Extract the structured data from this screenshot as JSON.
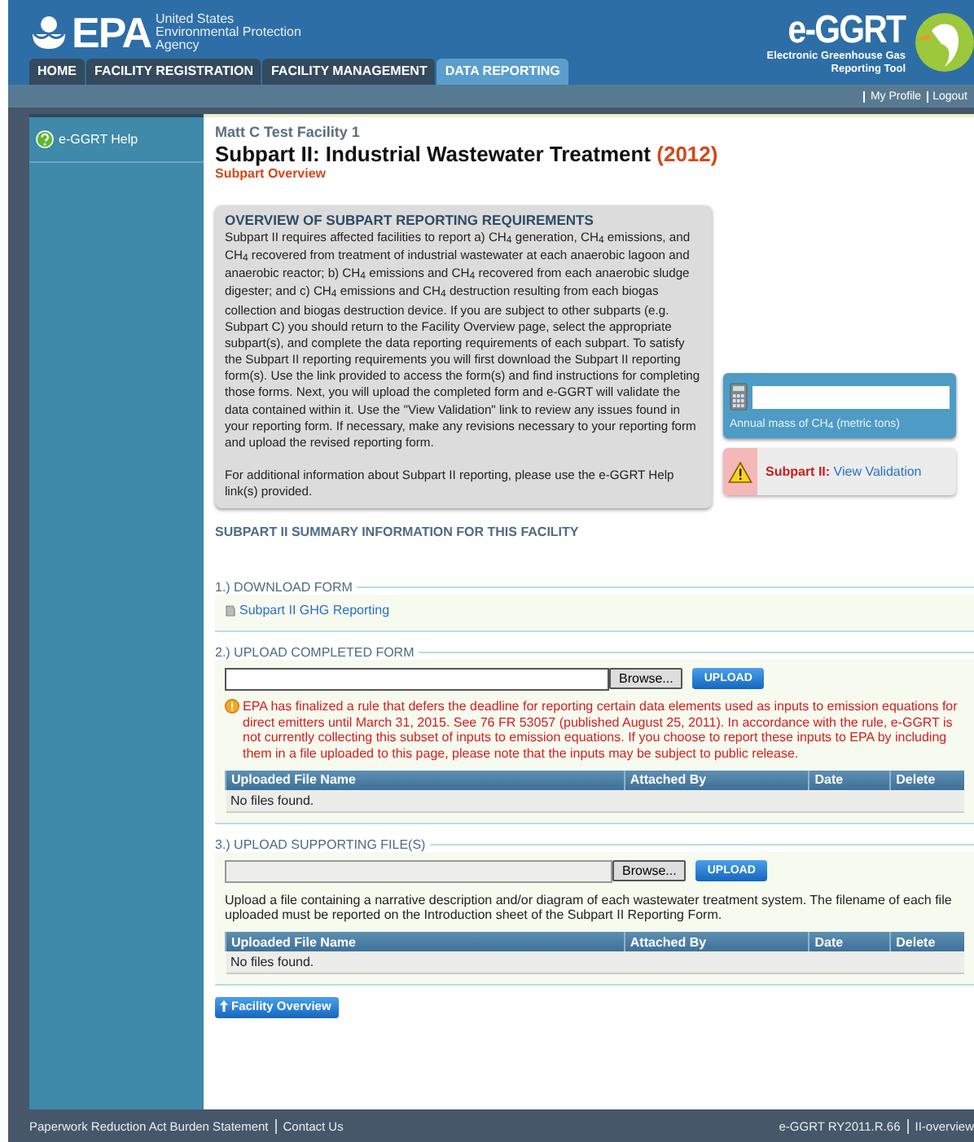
{
  "header": {
    "logo": "EPA",
    "agency_lines": [
      "United States",
      "Environmental Protection",
      "Agency"
    ],
    "app_logo": "e-GGRT",
    "app_subtitle_lines": [
      "Electronic Greenhouse Gas",
      "Reporting Tool"
    ]
  },
  "tabs": [
    {
      "label": "HOME",
      "selected": false
    },
    {
      "label": "FACILITY REGISTRATION",
      "selected": false
    },
    {
      "label": "FACILITY MANAGEMENT",
      "selected": false
    },
    {
      "label": "DATA REPORTING",
      "selected": true
    }
  ],
  "user_links": [
    "My Profile",
    "Logout"
  ],
  "sidebar": {
    "items": [
      {
        "label": "e-GGRT Help"
      }
    ]
  },
  "page": {
    "facility": "Matt C Test Facility 1",
    "title": "Subpart II: Industrial Wastewater Treatment",
    "year": "(2012)",
    "subtitle": "Subpart Overview"
  },
  "overview": {
    "heading": "OVERVIEW OF SUBPART REPORTING REQUIREMENTS",
    "paragraphs": [
      "Subpart II requires affected facilities to report a) CH$_{4}$ generation, CH$_{4}$ emissions, and CH$_{4}$ recovered from treatment of industrial wastewater at each anaerobic lagoon and anaerobic reactor; b) CH$_{4}$ emissions and CH$_{4}$ recovered from each anaerobic sludge digester; and c) CH$_{4}$ emissions and CH$_{4}$ destruction resulting from each biogas collection and biogas destruction device. If you are subject to other subparts (e.g. Subpart C) you should return to the Facility Overview page, select the appropriate subpart(s), and complete the data reporting requirements of each subpart. To satisfy the Subpart II reporting requirements you will first download the Subpart II reporting form(s). Use the link provided to access the form(s) and find instructions for completing those forms. Next, you will upload the completed form and e-GGRT will validate the data contained within it. Use the \"View Validation\" link to review any issues found in your reporting form. If necessary, make any revisions necessary to your reporting form and upload the revised reporting form.",
      "For additional information about Subpart II reporting, please use the e-GGRT Help link(s) provided."
    ]
  },
  "calculator": {
    "label": "Annual mass of CH$_{4}$ (metric tons)"
  },
  "validation": {
    "prefix": "Subpart II:",
    "link": "View Validation"
  },
  "summary_heading": "SUBPART II SUMMARY INFORMATION FOR THIS FACILITY",
  "sections": [
    {
      "kind": "download",
      "legend": "1.) DOWNLOAD FORM",
      "links": [
        "Subpart II GHG Reporting"
      ]
    },
    {
      "kind": "upload",
      "legend": "2.) UPLOAD COMPLETED FORM",
      "field_disabled": false,
      "browse": "Browse...",
      "upload": "UPLOAD",
      "warning": "EPA has finalized a rule that defers the deadline for reporting certain data elements used as inputs to emission equations for direct emitters until March 31, 2015. See 76 FR 53057 (published August 25, 2011). In accordance with the rule, e-GGRT is not currently collecting this subset of inputs to emission equations. If you choose to report these inputs to EPA by including them in a file uploaded to this page, please note that the inputs may be subject to public release.",
      "columns": [
        "Uploaded File Name",
        "Attached By",
        "Date",
        "Delete"
      ],
      "empty": "No files found."
    },
    {
      "kind": "upload",
      "legend": "3.) UPLOAD SUPPORTING FILE(S)",
      "field_disabled": true,
      "browse": "Browse...",
      "upload": "UPLOAD",
      "note": "Upload a file containing a narrative description and/or diagram of each wastewater treatment system. The filename of each file uploaded must be reported on the Introduction sheet of the Subpart II Reporting Form.",
      "columns": [
        "Uploaded File Name",
        "Attached By",
        "Date",
        "Delete"
      ],
      "empty": "No files found."
    }
  ],
  "back_button": "Facility Overview",
  "footer": {
    "left": [
      "Paperwork Reduction Act Burden Statement",
      "Contact Us"
    ],
    "right": [
      "e-GGRT RY2011.R.66",
      "II-overview"
    ]
  }
}
